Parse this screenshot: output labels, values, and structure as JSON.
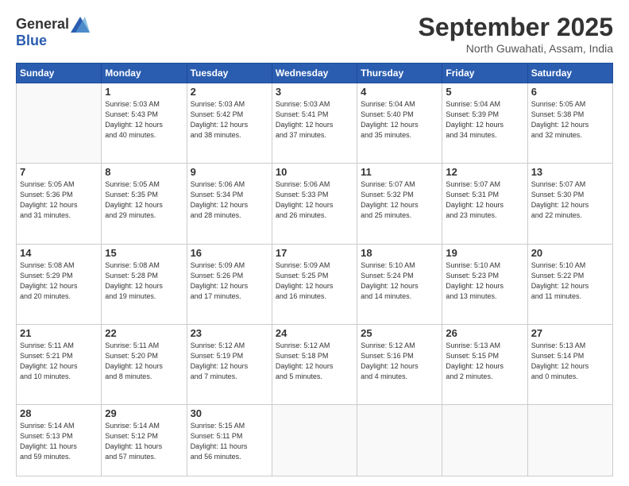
{
  "header": {
    "logo_general": "General",
    "logo_blue": "Blue",
    "title": "September 2025",
    "subtitle": "North Guwahati, Assam, India"
  },
  "days_of_week": [
    "Sunday",
    "Monday",
    "Tuesday",
    "Wednesday",
    "Thursday",
    "Friday",
    "Saturday"
  ],
  "weeks": [
    [
      {
        "day": "",
        "info": ""
      },
      {
        "day": "1",
        "info": "Sunrise: 5:03 AM\nSunset: 5:43 PM\nDaylight: 12 hours\nand 40 minutes."
      },
      {
        "day": "2",
        "info": "Sunrise: 5:03 AM\nSunset: 5:42 PM\nDaylight: 12 hours\nand 38 minutes."
      },
      {
        "day": "3",
        "info": "Sunrise: 5:03 AM\nSunset: 5:41 PM\nDaylight: 12 hours\nand 37 minutes."
      },
      {
        "day": "4",
        "info": "Sunrise: 5:04 AM\nSunset: 5:40 PM\nDaylight: 12 hours\nand 35 minutes."
      },
      {
        "day": "5",
        "info": "Sunrise: 5:04 AM\nSunset: 5:39 PM\nDaylight: 12 hours\nand 34 minutes."
      },
      {
        "day": "6",
        "info": "Sunrise: 5:05 AM\nSunset: 5:38 PM\nDaylight: 12 hours\nand 32 minutes."
      }
    ],
    [
      {
        "day": "7",
        "info": "Sunrise: 5:05 AM\nSunset: 5:36 PM\nDaylight: 12 hours\nand 31 minutes."
      },
      {
        "day": "8",
        "info": "Sunrise: 5:05 AM\nSunset: 5:35 PM\nDaylight: 12 hours\nand 29 minutes."
      },
      {
        "day": "9",
        "info": "Sunrise: 5:06 AM\nSunset: 5:34 PM\nDaylight: 12 hours\nand 28 minutes."
      },
      {
        "day": "10",
        "info": "Sunrise: 5:06 AM\nSunset: 5:33 PM\nDaylight: 12 hours\nand 26 minutes."
      },
      {
        "day": "11",
        "info": "Sunrise: 5:07 AM\nSunset: 5:32 PM\nDaylight: 12 hours\nand 25 minutes."
      },
      {
        "day": "12",
        "info": "Sunrise: 5:07 AM\nSunset: 5:31 PM\nDaylight: 12 hours\nand 23 minutes."
      },
      {
        "day": "13",
        "info": "Sunrise: 5:07 AM\nSunset: 5:30 PM\nDaylight: 12 hours\nand 22 minutes."
      }
    ],
    [
      {
        "day": "14",
        "info": "Sunrise: 5:08 AM\nSunset: 5:29 PM\nDaylight: 12 hours\nand 20 minutes."
      },
      {
        "day": "15",
        "info": "Sunrise: 5:08 AM\nSunset: 5:28 PM\nDaylight: 12 hours\nand 19 minutes."
      },
      {
        "day": "16",
        "info": "Sunrise: 5:09 AM\nSunset: 5:26 PM\nDaylight: 12 hours\nand 17 minutes."
      },
      {
        "day": "17",
        "info": "Sunrise: 5:09 AM\nSunset: 5:25 PM\nDaylight: 12 hours\nand 16 minutes."
      },
      {
        "day": "18",
        "info": "Sunrise: 5:10 AM\nSunset: 5:24 PM\nDaylight: 12 hours\nand 14 minutes."
      },
      {
        "day": "19",
        "info": "Sunrise: 5:10 AM\nSunset: 5:23 PM\nDaylight: 12 hours\nand 13 minutes."
      },
      {
        "day": "20",
        "info": "Sunrise: 5:10 AM\nSunset: 5:22 PM\nDaylight: 12 hours\nand 11 minutes."
      }
    ],
    [
      {
        "day": "21",
        "info": "Sunrise: 5:11 AM\nSunset: 5:21 PM\nDaylight: 12 hours\nand 10 minutes."
      },
      {
        "day": "22",
        "info": "Sunrise: 5:11 AM\nSunset: 5:20 PM\nDaylight: 12 hours\nand 8 minutes."
      },
      {
        "day": "23",
        "info": "Sunrise: 5:12 AM\nSunset: 5:19 PM\nDaylight: 12 hours\nand 7 minutes."
      },
      {
        "day": "24",
        "info": "Sunrise: 5:12 AM\nSunset: 5:18 PM\nDaylight: 12 hours\nand 5 minutes."
      },
      {
        "day": "25",
        "info": "Sunrise: 5:12 AM\nSunset: 5:16 PM\nDaylight: 12 hours\nand 4 minutes."
      },
      {
        "day": "26",
        "info": "Sunrise: 5:13 AM\nSunset: 5:15 PM\nDaylight: 12 hours\nand 2 minutes."
      },
      {
        "day": "27",
        "info": "Sunrise: 5:13 AM\nSunset: 5:14 PM\nDaylight: 12 hours\nand 0 minutes."
      }
    ],
    [
      {
        "day": "28",
        "info": "Sunrise: 5:14 AM\nSunset: 5:13 PM\nDaylight: 11 hours\nand 59 minutes."
      },
      {
        "day": "29",
        "info": "Sunrise: 5:14 AM\nSunset: 5:12 PM\nDaylight: 11 hours\nand 57 minutes."
      },
      {
        "day": "30",
        "info": "Sunrise: 5:15 AM\nSunset: 5:11 PM\nDaylight: 11 hours\nand 56 minutes."
      },
      {
        "day": "",
        "info": ""
      },
      {
        "day": "",
        "info": ""
      },
      {
        "day": "",
        "info": ""
      },
      {
        "day": "",
        "info": ""
      }
    ]
  ]
}
